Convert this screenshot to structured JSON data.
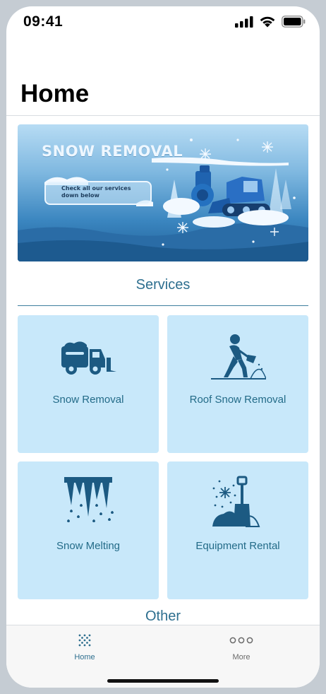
{
  "status_bar": {
    "time": "09:41",
    "icons": [
      "cellular-signal-icon",
      "wifi-icon",
      "battery-icon"
    ]
  },
  "header": {
    "title": "Home"
  },
  "banner": {
    "headline": "SNOW REMOVAL",
    "subtext": "Check all our services down below"
  },
  "services": {
    "title": "Services",
    "items": [
      {
        "label": "Snow Removal",
        "icon": "snow-plow-truck-icon"
      },
      {
        "label": "Roof Snow Removal",
        "icon": "person-shoveling-icon"
      },
      {
        "label": "Snow Melting",
        "icon": "melting-icicles-icon"
      },
      {
        "label": "Equipment Rental",
        "icon": "snow-shovel-icon"
      }
    ]
  },
  "other": {
    "title": "Other"
  },
  "tab_bar": {
    "tabs": [
      {
        "label": "Home",
        "icon": "home-dots-icon",
        "active": true
      },
      {
        "label": "More",
        "icon": "more-dots-icon",
        "active": false
      }
    ]
  },
  "colors": {
    "accent": "#2e6f8f",
    "card_background": "#c8e8fa",
    "card_icon": "#1c5a82"
  }
}
